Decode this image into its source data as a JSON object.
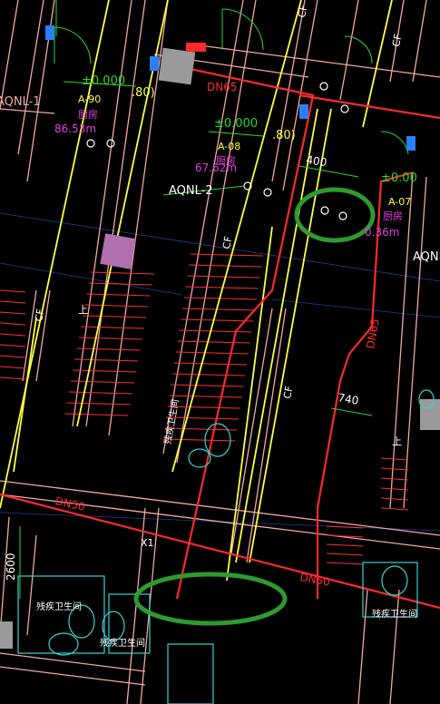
{
  "drawing": {
    "colors": {
      "background": "#000000",
      "wall_pink": "#f4a6a6",
      "pipe_yellow": "#ffff3c",
      "pipe_red": "#ff2a2a",
      "dim_green": "#2bd82b",
      "label_white": "#ffffff",
      "label_magenta": "#e040e0",
      "label_yellow": "#ffff3c",
      "fixture_cyan": "#39d2d2",
      "hatch_red": "#ff3030",
      "highlight_green": "#2f9a2f",
      "block_grey": "#9a9a9a",
      "block_purple": "#b070b0",
      "blue": "#2a7fff"
    },
    "labels": {
      "room_code_1": "A-90",
      "room_name_1": "厨房",
      "area_1": "86.53m",
      "level_1": "±0.000",
      "paren_1": ".80)",
      "room_code_2": "A-08",
      "room_name_2": "厨房",
      "area_2": "67.62m",
      "level_2": "±0.000",
      "paren_2": ".80)",
      "room_code_3": "A-07",
      "room_name_3": "厨房",
      "area_3": "0.36m",
      "level_3": "±0.00",
      "tag_1": "AQNL-1",
      "tag_2": "AQNL-2",
      "tag_3": "AQNL",
      "dn_1": "DN65",
      "dn_2": "DN65",
      "dn_3": "DN50",
      "dn_4": "DN50",
      "dim_400": "400",
      "dim_740": "740",
      "dim_2600": "2600",
      "bath_1": "残疾卫生间",
      "bath_2": "残疾卫生间",
      "bath_3": "残疾卫生间",
      "bath_4": "残疾卫生间",
      "pipe_cf": "CF",
      "axis_x1": "X1",
      "stair_up": "上"
    }
  }
}
